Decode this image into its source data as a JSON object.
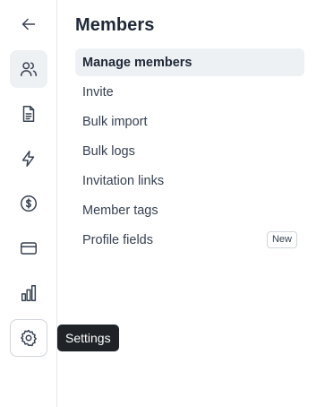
{
  "rail": {
    "items": [
      {
        "icon": "arrow-left-icon",
        "state": "default"
      },
      {
        "icon": "users-icon",
        "state": "active"
      },
      {
        "icon": "document-icon",
        "state": "default"
      },
      {
        "icon": "lightning-icon",
        "state": "default"
      },
      {
        "icon": "dollar-circle-icon",
        "state": "default"
      },
      {
        "icon": "credit-card-icon",
        "state": "default"
      },
      {
        "icon": "bar-chart-icon",
        "state": "default"
      },
      {
        "icon": "gear-icon",
        "state": "hovered"
      }
    ]
  },
  "tooltip": {
    "text": "Settings"
  },
  "panel": {
    "title": "Members",
    "items": [
      {
        "label": "Manage members",
        "active": true
      },
      {
        "label": "Invite"
      },
      {
        "label": "Bulk import"
      },
      {
        "label": "Bulk logs"
      },
      {
        "label": "Invitation links"
      },
      {
        "label": "Member tags"
      },
      {
        "label": "Profile fields",
        "badge": "New"
      }
    ]
  },
  "colors": {
    "active_bg": "#eef1f4",
    "tooltip_bg": "#1f2327",
    "divider": "#e5e7eb"
  }
}
